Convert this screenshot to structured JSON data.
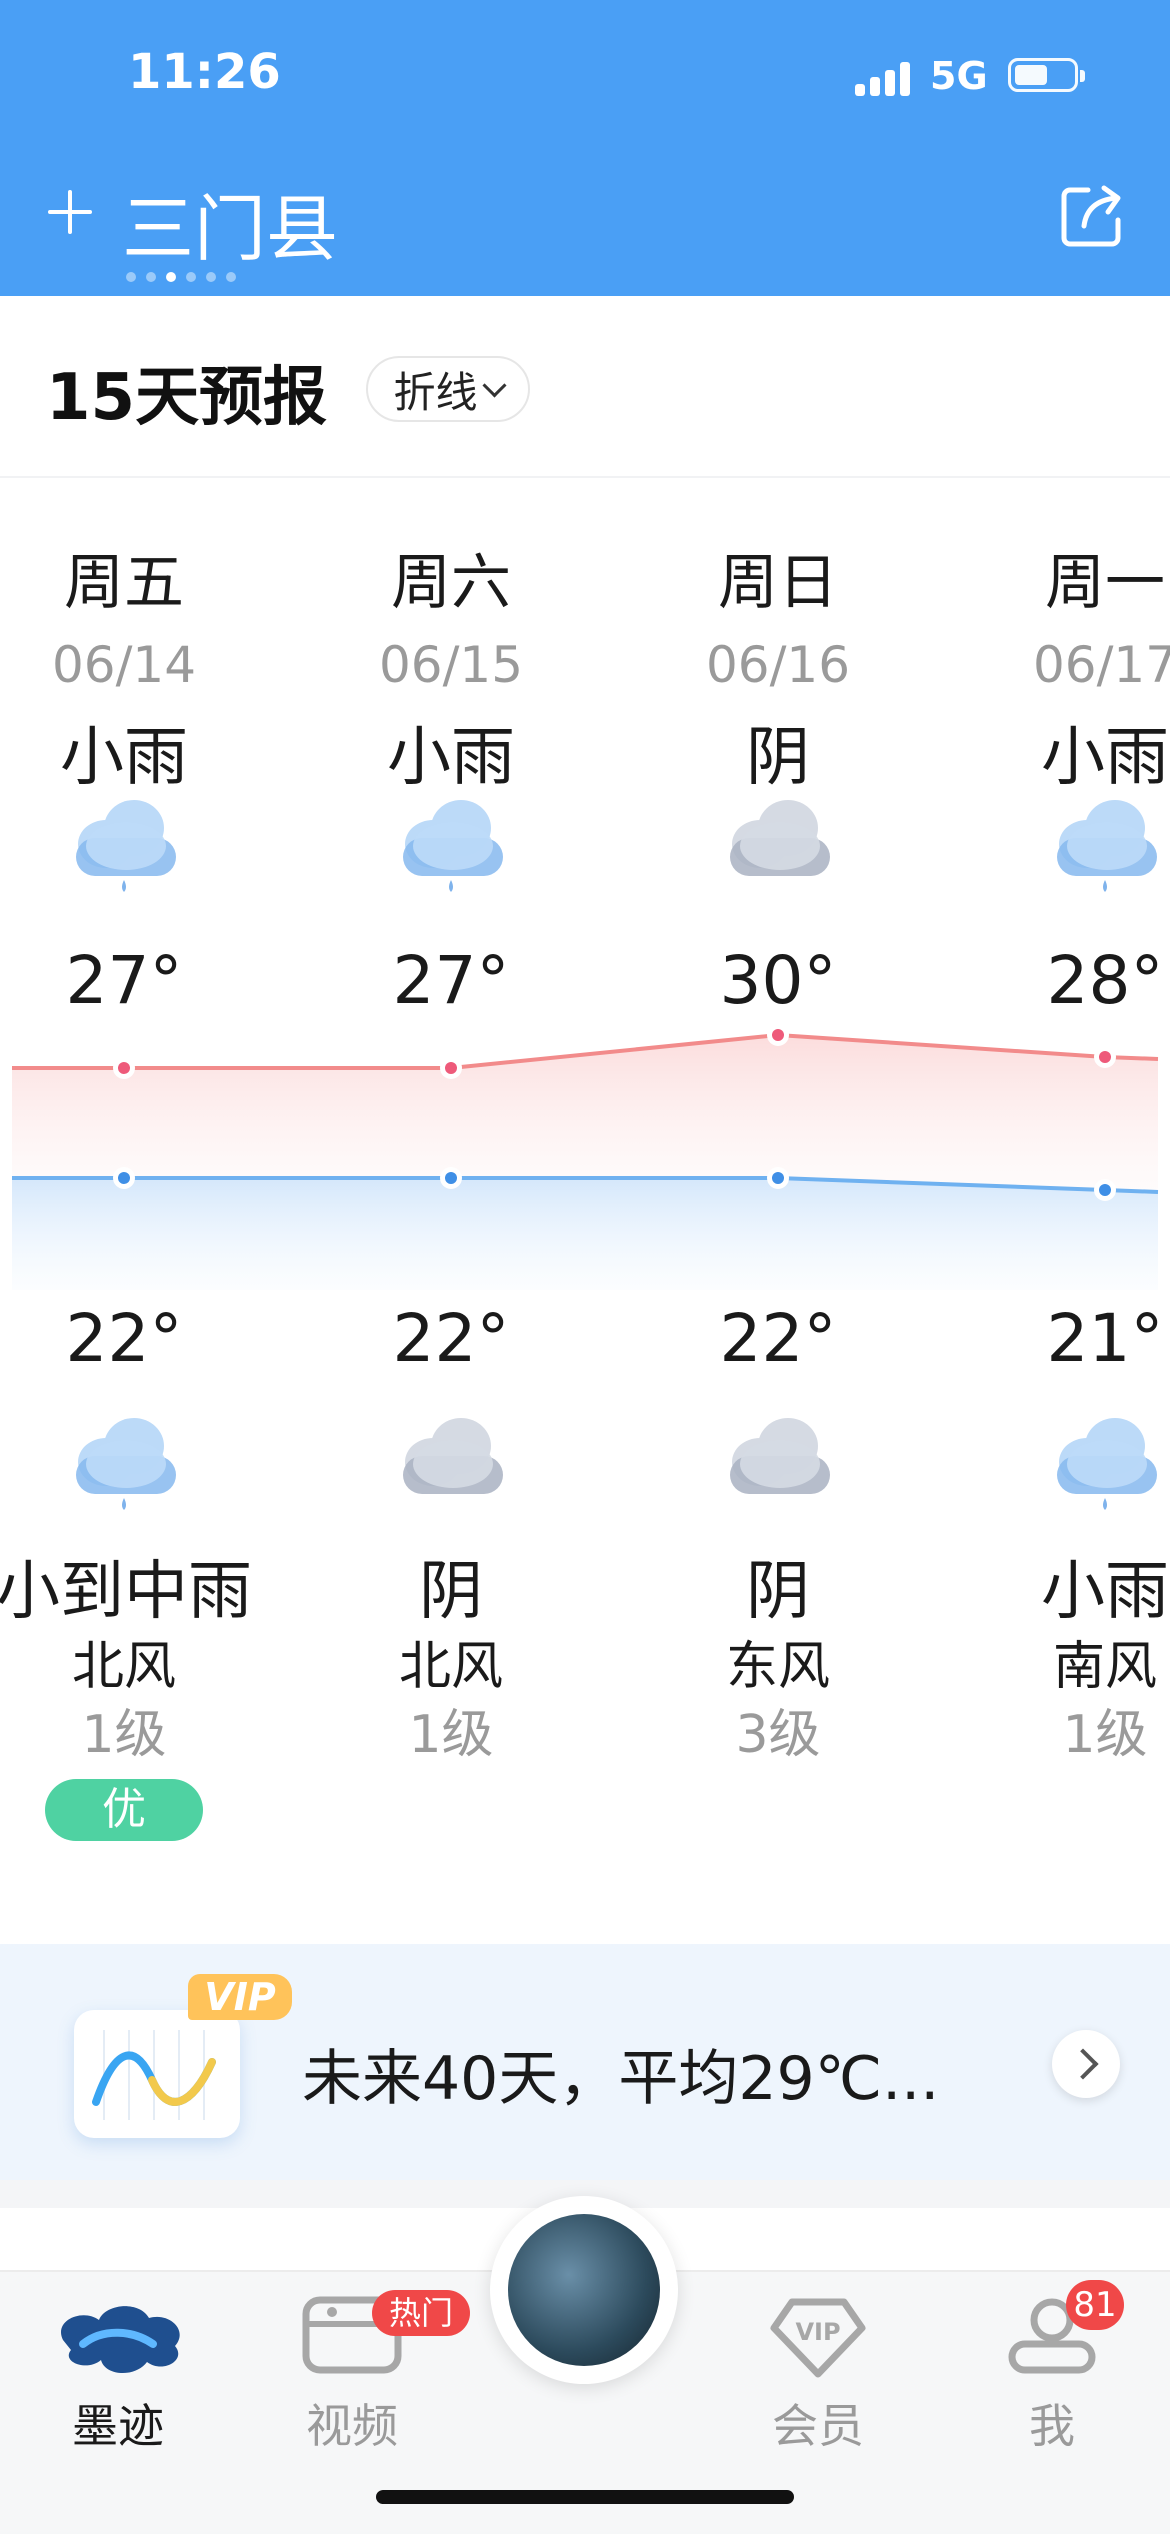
{
  "status_bar": {
    "time": "11:26",
    "network": "5G"
  },
  "header": {
    "city": "三门县"
  },
  "forecast": {
    "title": "15天预报",
    "mode": "折线"
  },
  "days": [
    {
      "weekday": "周五",
      "date": "06/14",
      "day_condition": "小雨",
      "day_icon": "light-rain-icon",
      "high": "27°",
      "low": "22°",
      "night_icon": "light-rain-icon",
      "night_condition": "小到中雨",
      "wind_dir": "北风",
      "wind_level": "1级",
      "aqi": "优",
      "high_value": 27,
      "low_value": 22
    },
    {
      "weekday": "周六",
      "date": "06/15",
      "day_condition": "小雨",
      "day_icon": "light-rain-icon",
      "high": "27°",
      "low": "22°",
      "night_icon": "overcast-icon",
      "night_condition": "阴",
      "wind_dir": "北风",
      "wind_level": "1级",
      "high_value": 27,
      "low_value": 22
    },
    {
      "weekday": "周日",
      "date": "06/16",
      "day_condition": "阴",
      "day_icon": "overcast-icon",
      "high": "30°",
      "low": "22°",
      "night_icon": "overcast-icon",
      "night_condition": "阴",
      "wind_dir": "东风",
      "wind_level": "3级",
      "high_value": 30,
      "low_value": 22
    },
    {
      "weekday": "周一",
      "date": "06/17",
      "day_condition": "小雨",
      "day_icon": "light-rain-icon",
      "high": "28°",
      "low": "21°",
      "night_icon": "light-rain-icon",
      "night_condition": "小雨",
      "wind_dir": "南风",
      "wind_level": "1级",
      "high_value": 28,
      "low_value": 21
    }
  ],
  "vip_banner": {
    "badge": "VIP",
    "text": "未来40天，平均29℃..."
  },
  "nav": {
    "tabs": [
      {
        "label": "墨迹",
        "icon": "moji-logo-icon",
        "active": true
      },
      {
        "label": "视频",
        "icon": "video-icon",
        "badge": "热门"
      },
      {
        "label": "",
        "icon": "center-weather-photo"
      },
      {
        "label": "会员",
        "icon": "vip-diamond-icon"
      },
      {
        "label": "我",
        "icon": "profile-icon",
        "badge": "81"
      }
    ]
  },
  "colors": {
    "header_bg": "#4a9ff5",
    "high_line": "#f28b8b",
    "low_line": "#6fb1f0",
    "aqi_good": "#4fd2a2",
    "active_tab": "#1a1a1a",
    "inactive_tab": "#9a9a9a"
  }
}
